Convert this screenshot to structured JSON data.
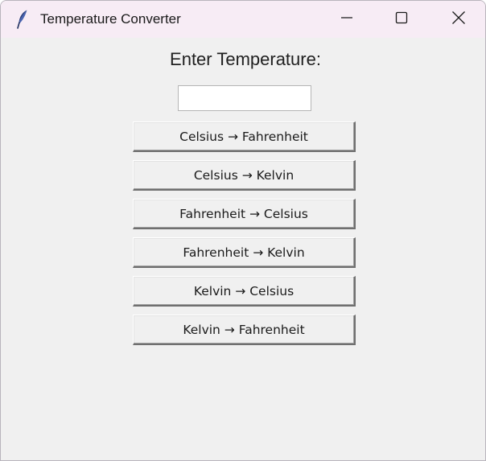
{
  "window": {
    "title": "Temperature Converter",
    "app_icon": "feather-icon",
    "controls": {
      "minimize": "minimize-icon",
      "maximize": "maximize-icon",
      "close": "close-icon"
    }
  },
  "main": {
    "prompt_label": "Enter Temperature:",
    "temperature_input": {
      "value": "",
      "placeholder": ""
    },
    "buttons": [
      {
        "label": "Celsius → Fahrenheit"
      },
      {
        "label": "Celsius → Kelvin"
      },
      {
        "label": "Fahrenheit → Celsius"
      },
      {
        "label": "Fahrenheit → Kelvin"
      },
      {
        "label": "Kelvin → Celsius"
      },
      {
        "label": "Kelvin → Fahrenheit"
      }
    ]
  }
}
